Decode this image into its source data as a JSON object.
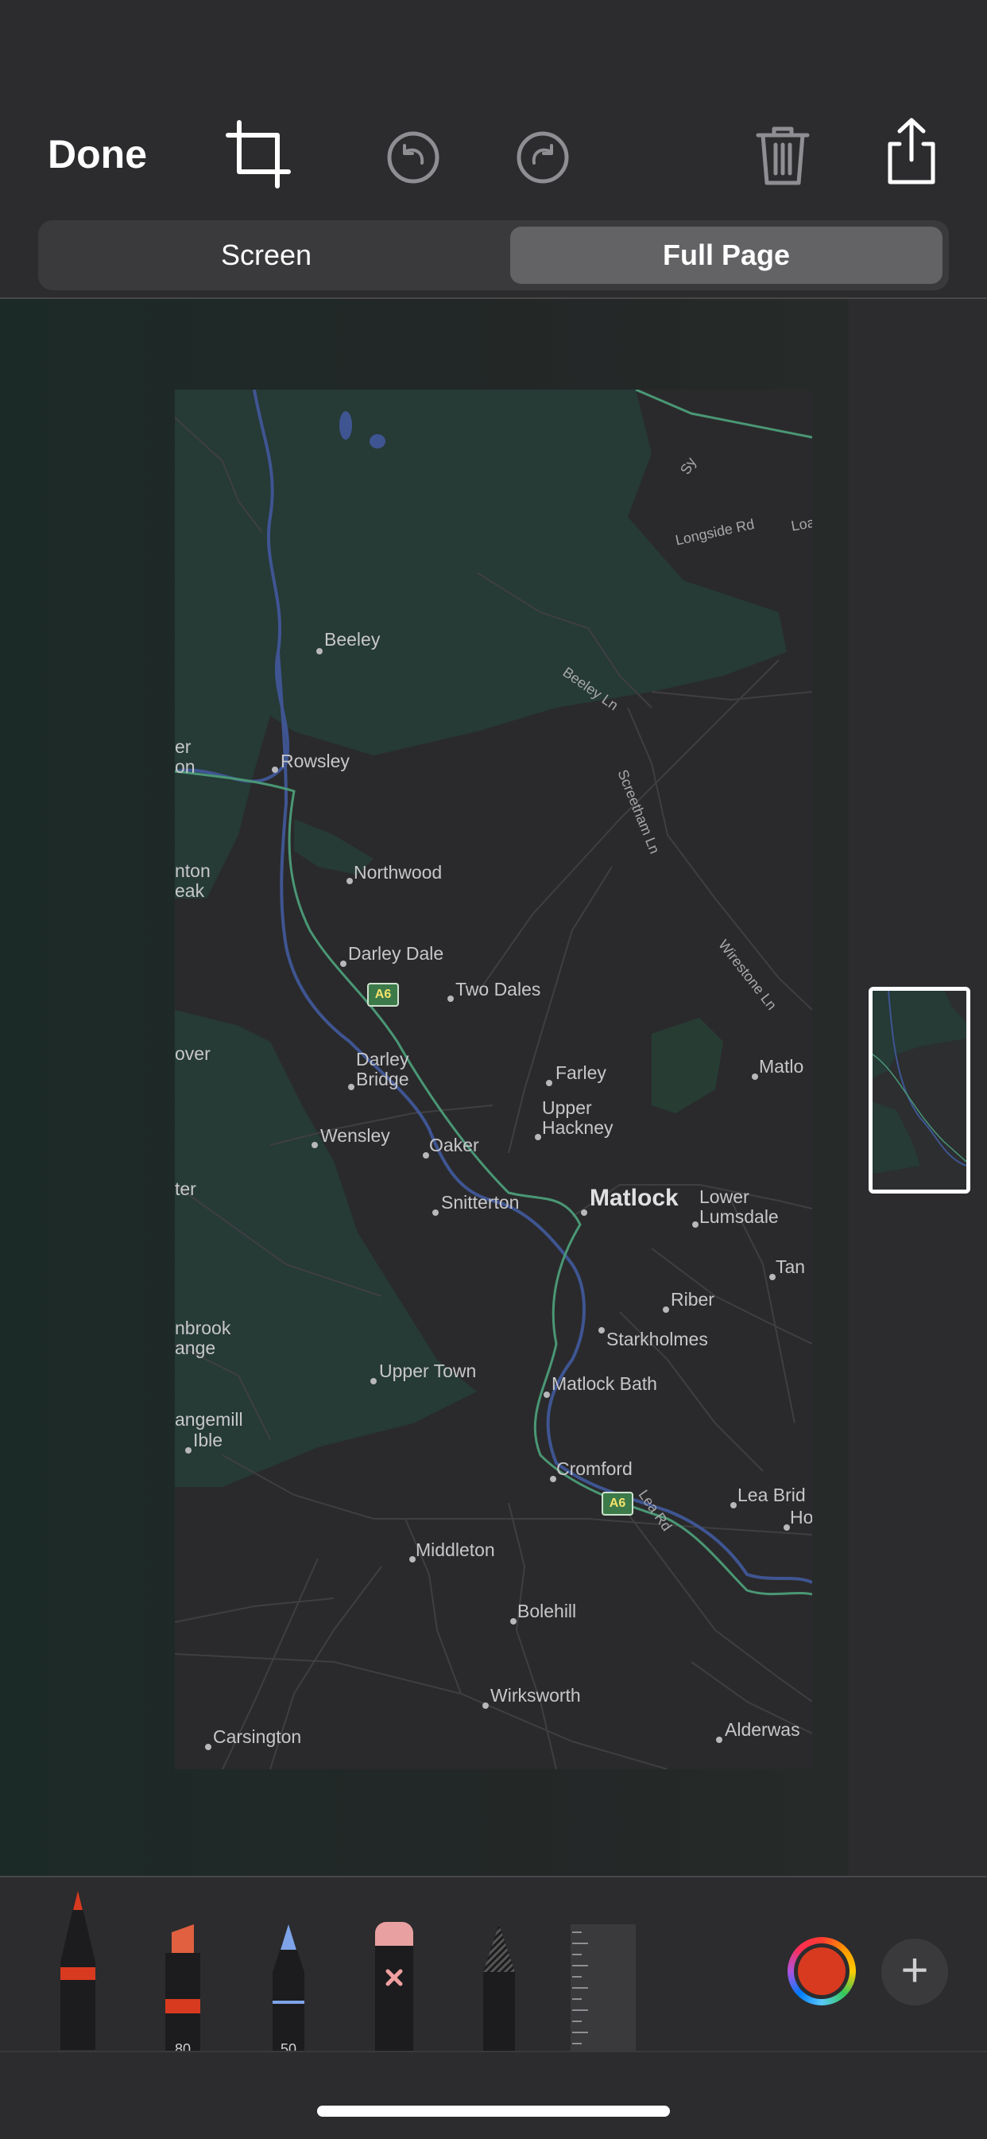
{
  "toolbar": {
    "done_label": "Done",
    "icons": [
      "crop-icon",
      "undo-icon",
      "redo-icon",
      "trash-icon",
      "share-icon"
    ]
  },
  "segmented": {
    "options": [
      "Screen",
      "Full Page"
    ],
    "selected": "Full Page"
  },
  "map": {
    "places": [
      {
        "name": "Beeley"
      },
      {
        "name": "Rowsley"
      },
      {
        "name": "Northwood"
      },
      {
        "name": "Darley Dale"
      },
      {
        "name": "Two Dales"
      },
      {
        "name": "Darley\nBridge"
      },
      {
        "name": "Farley"
      },
      {
        "name": "Upper\nHackney"
      },
      {
        "name": "Wensley"
      },
      {
        "name": "Oaker"
      },
      {
        "name": "Snitterton"
      },
      {
        "name": "Matlock"
      },
      {
        "name": "Lower\nLumsdale"
      },
      {
        "name": "Riber"
      },
      {
        "name": "Starkholmes"
      },
      {
        "name": "Upper Town"
      },
      {
        "name": "Matlock Bath"
      },
      {
        "name": "Cromford"
      },
      {
        "name": "Lea Brid"
      },
      {
        "name": "Middleton"
      },
      {
        "name": "Bolehill"
      },
      {
        "name": "Wirksworth"
      },
      {
        "name": "Carsington"
      },
      {
        "name": "Alderwas"
      },
      {
        "name": "Matlo"
      },
      {
        "name": "Tan"
      },
      {
        "name": "Ho"
      },
      {
        "name": "er\non"
      },
      {
        "name": "nton\neak"
      },
      {
        "name": "over"
      },
      {
        "name": "ter"
      },
      {
        "name": "nbrook\nange"
      },
      {
        "name": "angemill"
      },
      {
        "name": "Ible"
      }
    ],
    "roads": [
      "Longside Rd",
      "Loa",
      "Sy",
      "Beeley Ln",
      "Screetham Ln",
      "Wirestone Ln",
      "Lea Rd"
    ],
    "shields": [
      "A6",
      "A6"
    ]
  },
  "tools": [
    {
      "name": "pen",
      "number": ""
    },
    {
      "name": "marker",
      "number": "80"
    },
    {
      "name": "pencil",
      "number": "50"
    },
    {
      "name": "eraser",
      "number": ""
    },
    {
      "name": "lasso",
      "number": ""
    },
    {
      "name": "ruler",
      "number": ""
    }
  ],
  "palette": {
    "current_color": "#d83a20",
    "add_label": "+"
  },
  "colors": {
    "background": "#2c2c2e",
    "segment_selected": "#636366",
    "map_land": "#2a2a2c",
    "map_park": "#263a36",
    "map_river": "#3f5592",
    "map_main_road": "#4a9775"
  }
}
